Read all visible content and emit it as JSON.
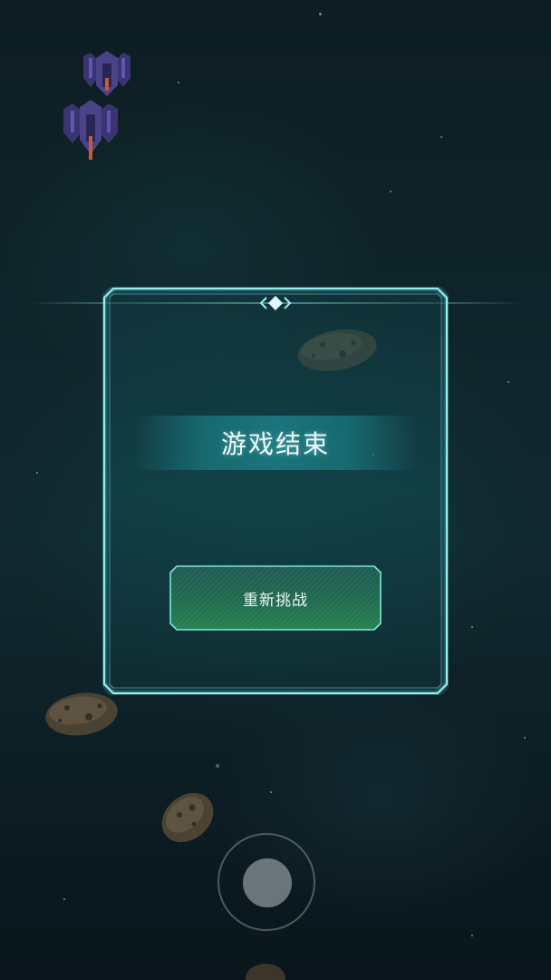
{
  "dialog": {
    "title": "游戏结束",
    "retry_button_label": "重新挑战"
  },
  "colors": {
    "frame_glow": "#8ef0f0",
    "title_band": "#1c7e86",
    "button_fill": "#1f6a4e",
    "button_border": "#7fe6d8"
  },
  "icons": {
    "enemy_ship": "enemy-ship-icon",
    "asteroid": "asteroid-icon",
    "joystick": "joystick-icon"
  }
}
